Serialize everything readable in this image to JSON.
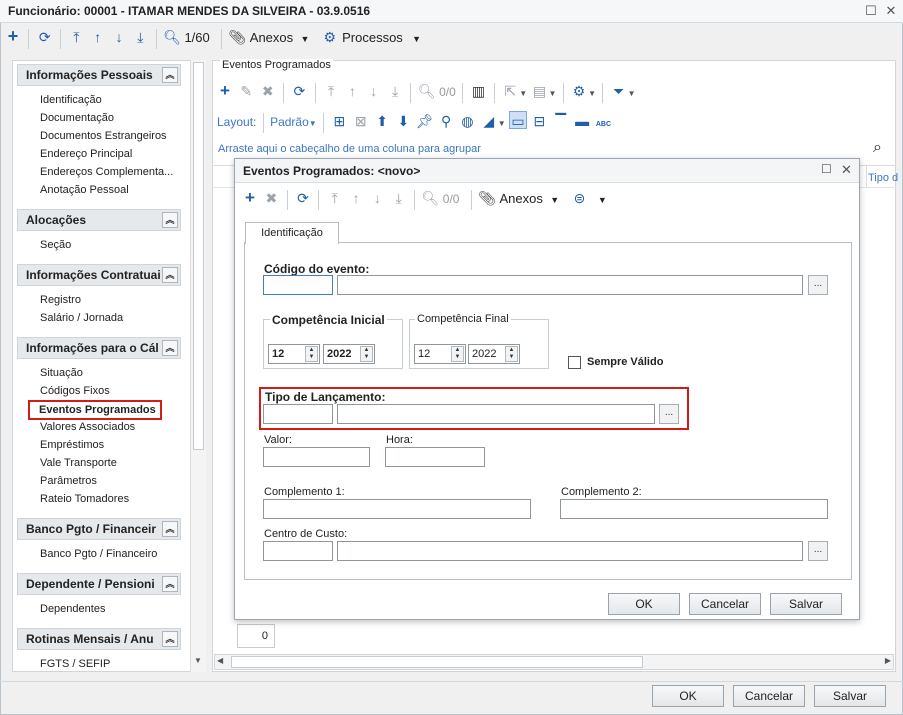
{
  "window": {
    "title": "Funcionário: 00001 - ITAMAR MENDES DA SILVEIRA - 03.9.0516"
  },
  "toolbar": {
    "page_count": "1/60",
    "attachments": "Anexos",
    "processes": "Processos"
  },
  "sidebar": {
    "groups": [
      {
        "title": "Informações Pessoais",
        "items": [
          "Identificação",
          "Documentação",
          "Documentos Estrangeiros",
          "Endereço Principal",
          "Endereços Complementa...",
          "Anotação Pessoal"
        ]
      },
      {
        "title": "Alocações",
        "items": [
          "Seção"
        ]
      },
      {
        "title": "Informações Contratuai",
        "items": [
          "Registro",
          "Salário / Jornada"
        ]
      },
      {
        "title": "Informações para o Cál",
        "items": [
          "Situação",
          "Códigos Fixos",
          "Eventos Programados",
          "Valores Associados",
          "Empréstimos",
          "Vale Transporte",
          "Parâmetros",
          "Rateio Tomadores"
        ]
      },
      {
        "title": "Banco Pgto / Financeir",
        "items": [
          "Banco Pgto / Financeiro"
        ]
      },
      {
        "title": "Dependente / Pensioni",
        "items": [
          "Dependentes"
        ]
      },
      {
        "title": "Rotinas Mensais / Anu",
        "items": [
          "FGTS / SEFIP"
        ]
      }
    ]
  },
  "main": {
    "section_label": "Eventos Programados",
    "record_count": "0/0",
    "layout_label": "Layout:",
    "layout_value": "Padrão",
    "group_hint": "Arraste aqui o cabeçalho de uma coluna para agrupar",
    "column_header": "Tipo d",
    "footer_count": "0"
  },
  "dialog": {
    "title": "Eventos Programados: <novo>",
    "record_count": "0/0",
    "attachments": "Anexos",
    "tab": "Identificação",
    "event_code_label": "Código do evento:",
    "comp_initial_label": "Competência Inicial",
    "comp_final_label": "Competência Final",
    "comp_initial_month": "12",
    "comp_initial_year": "2022",
    "comp_final_month": "12",
    "comp_final_year": "2022",
    "always_valid_label": "Sempre Válido",
    "launch_type_label": "Tipo de Lançamento:",
    "value_label": "Valor:",
    "hour_label": "Hora:",
    "complement1_label": "Complemento 1:",
    "complement2_label": "Complemento 2:",
    "cost_center_label": "Centro de Custo:",
    "ok": "OK",
    "cancel": "Cancelar",
    "save": "Salvar"
  },
  "footer": {
    "ok": "OK",
    "cancel": "Cancelar",
    "save": "Salvar"
  },
  "colors": {
    "accent": "#1f5fa8",
    "highlight": "#d21b1b",
    "link": "#3a78c2"
  }
}
